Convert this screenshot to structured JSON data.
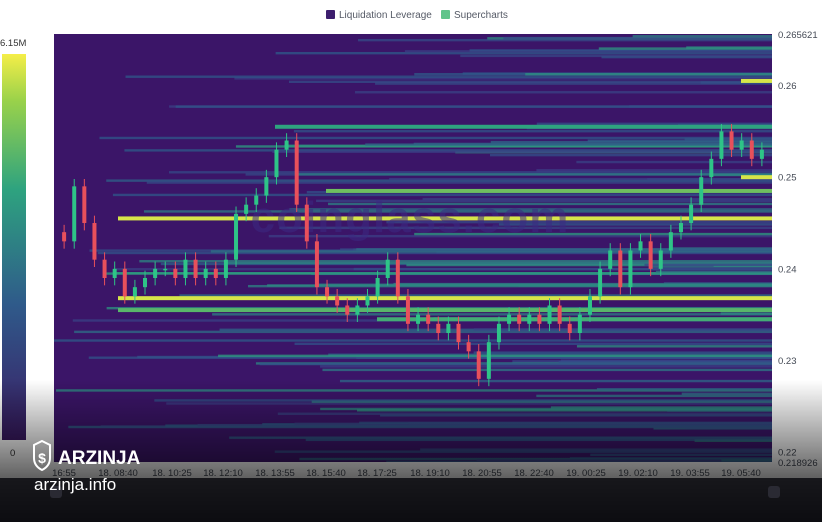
{
  "chart_data": {
    "type": "heatmap",
    "title": "",
    "legend": [
      {
        "label": "Liquidation Leverage",
        "color": "#3d1e6e"
      },
      {
        "label": "Supercharts",
        "color": "#5fc48a"
      }
    ],
    "x_ticks": [
      "16:55",
      "18. 08:40",
      "18. 10:25",
      "18. 12:10",
      "18. 13:55",
      "18. 15:40",
      "18. 17:25",
      "18. 19:10",
      "18. 20:55",
      "18. 22:40",
      "19. 00:25",
      "19. 02:10",
      "19. 03:55",
      "19. 05:40"
    ],
    "y_ticks": [
      {
        "label": "0.265621",
        "value": 0.265621
      },
      {
        "label": "0.26",
        "value": 0.26
      },
      {
        "label": "0.25",
        "value": 0.25
      },
      {
        "label": "0.24",
        "value": 0.24
      },
      {
        "label": "0.23",
        "value": 0.23
      },
      {
        "label": "0.22",
        "value": 0.22
      },
      {
        "label": "0.218926",
        "value": 0.218926
      }
    ],
    "ylim": [
      0.218926,
      0.265621
    ],
    "colorbar": {
      "max_label": "6.15M",
      "min_label": "0",
      "max": 6150000,
      "min": 0
    },
    "price_path": [
      0.244,
      0.243,
      0.249,
      0.245,
      0.241,
      0.239,
      0.24,
      0.237,
      0.238,
      0.239,
      0.24,
      0.24,
      0.239,
      0.241,
      0.239,
      0.24,
      0.239,
      0.241,
      0.246,
      0.247,
      0.248,
      0.25,
      0.253,
      0.254,
      0.247,
      0.243,
      0.238,
      0.237,
      0.236,
      0.235,
      0.236,
      0.237,
      0.239,
      0.241,
      0.237,
      0.234,
      0.235,
      0.234,
      0.233,
      0.234,
      0.232,
      0.231,
      0.228,
      0.232,
      0.234,
      0.235,
      0.234,
      0.235,
      0.234,
      0.236,
      0.234,
      0.233,
      0.235,
      0.237,
      0.24,
      0.242,
      0.238,
      0.242,
      0.243,
      0.24,
      0.242,
      0.244,
      0.245,
      0.247,
      0.25,
      0.252,
      0.255,
      0.253,
      0.254,
      0.252,
      0.253
    ],
    "liquidation_levels": [
      {
        "price": 0.2605,
        "x_start": "19. 05:40",
        "intensity": 0.95
      },
      {
        "price": 0.25,
        "x_start": "19. 05:40",
        "intensity": 0.95
      },
      {
        "price": 0.2555,
        "x_start": "18. 13:55",
        "intensity": 0.6
      },
      {
        "price": 0.2485,
        "x_start": "18. 15:40",
        "intensity": 0.75
      },
      {
        "price": 0.2455,
        "x_start": "18. 08:40",
        "intensity": 0.95
      },
      {
        "price": 0.2368,
        "x_start": "18. 08:40",
        "intensity": 0.95
      },
      {
        "price": 0.2355,
        "x_start": "18. 08:40",
        "intensity": 0.7
      },
      {
        "price": 0.2345,
        "x_start": "18. 17:25",
        "intensity": 0.65
      }
    ]
  },
  "watermark": "coinglass.com",
  "branding": {
    "name": "ARZINJA",
    "site": "arzinja.info"
  }
}
